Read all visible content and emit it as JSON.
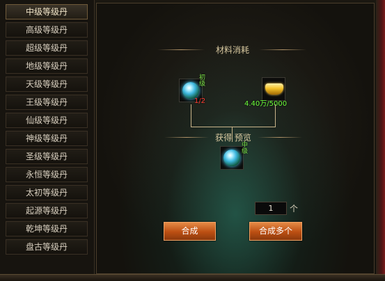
{
  "sidebar": {
    "items": [
      {
        "label": "中级等级丹",
        "active": true
      },
      {
        "label": "高级等级丹"
      },
      {
        "label": "超级等级丹"
      },
      {
        "label": "地级等级丹"
      },
      {
        "label": "天级等级丹"
      },
      {
        "label": "王级等级丹"
      },
      {
        "label": "仙级等级丹"
      },
      {
        "label": "神级等级丹"
      },
      {
        "label": "圣级等级丹"
      },
      {
        "label": "永恒等级丹"
      },
      {
        "label": "太初等级丹"
      },
      {
        "label": "起源等级丹"
      },
      {
        "label": "乾坤等级丹"
      },
      {
        "label": "盘古等级丹"
      }
    ]
  },
  "main": {
    "materials_title": "材料消耗",
    "material_1": {
      "icon": "green-orb-icon",
      "tag": "初级",
      "count": "1/2",
      "count_color": "#ff3b30"
    },
    "material_2": {
      "icon": "gold-ingot-icon",
      "count": "4.40万/5000",
      "count_color": "#6cff3a"
    },
    "preview_title": "获得 预览",
    "result": {
      "icon": "green-orb-icon",
      "tag": "中级"
    },
    "quantity_value": "1",
    "quantity_unit": "个",
    "combine_button": "合成",
    "combine_multi_button": "合成多个"
  }
}
